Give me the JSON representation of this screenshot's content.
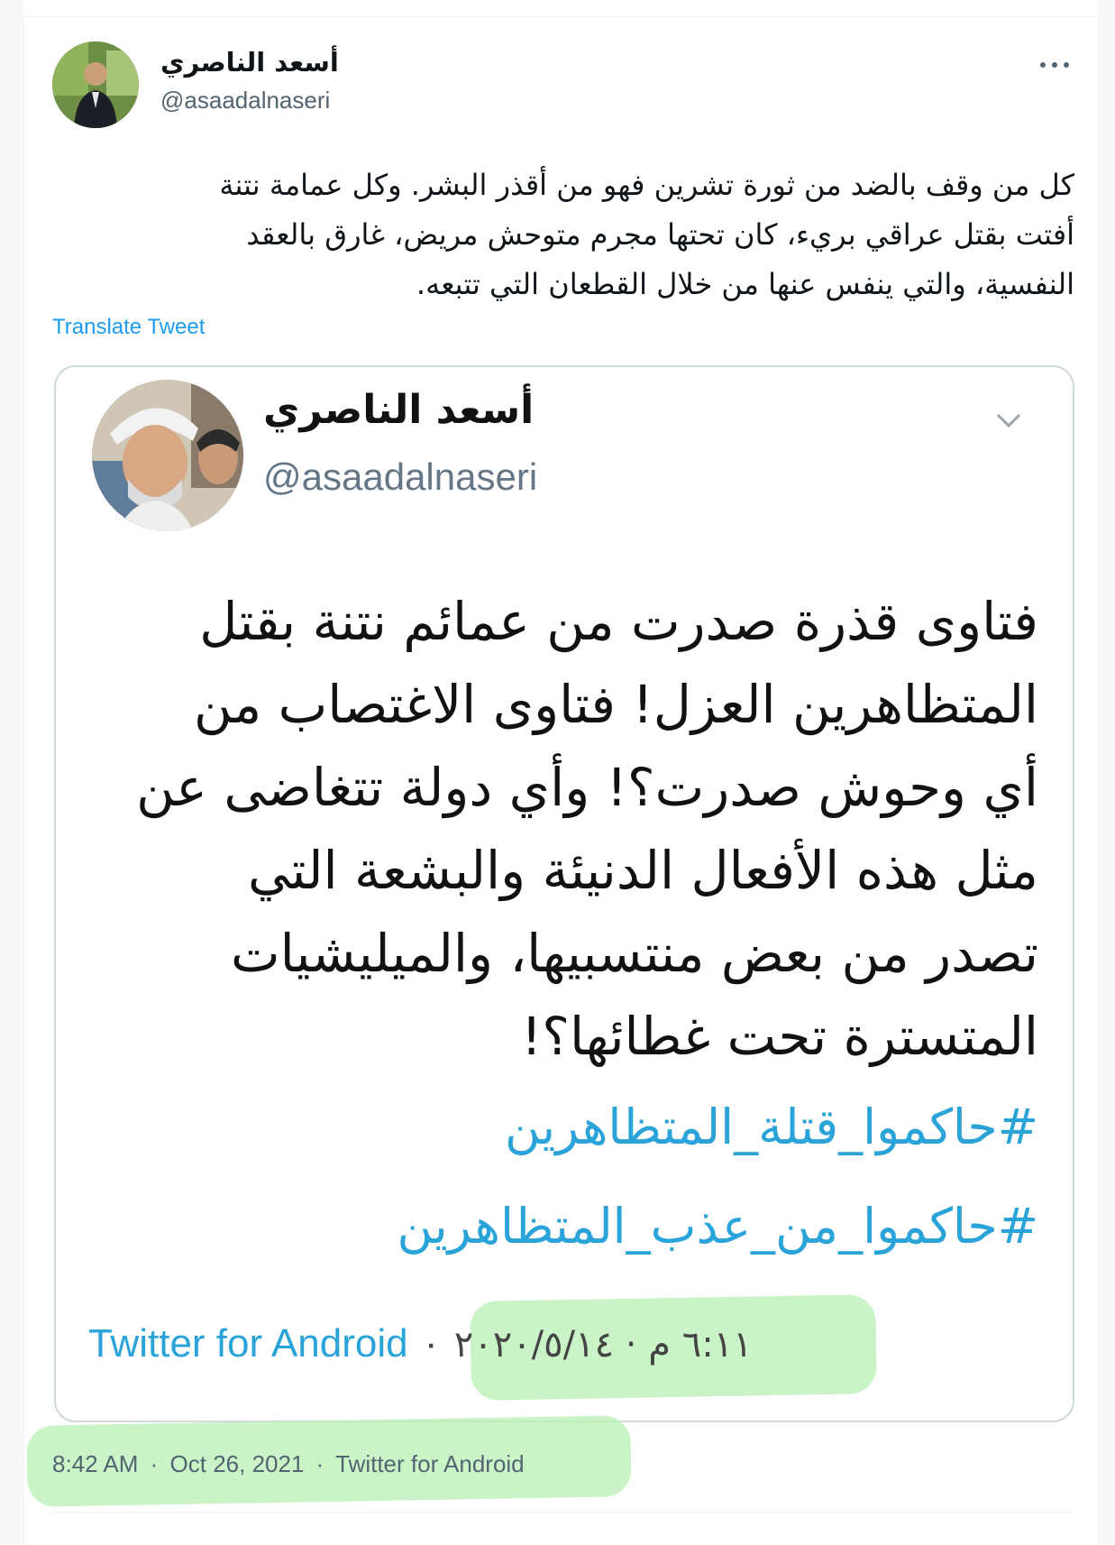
{
  "tweet": {
    "display_name": "أسعد الناصري",
    "handle": "@asaadalnaseri",
    "text_lines": [
      "كل من وقف بالضد من ثورة تشرين فهو من أقذر البشر. وكل عمامة نتنة",
      "أفتت بقتل عراقي بريء، كان تحتها مجرم متوحش مريض، غارق بالعقد",
      "النفسية، والتي ينفس عنها من خلال القطعان التي تتبعه."
    ],
    "translate_label": "Translate Tweet",
    "time": "8:42 AM",
    "date": "Oct 26, 2021",
    "source": "Twitter for Android",
    "separator": "·"
  },
  "quoted": {
    "display_name": "أسعد الناصري",
    "handle": "@asaadalnaseri",
    "body_lines": [
      "فتاوى قذرة صدرت من عمائم نتنة بقتل",
      "المتظاهرين العزل! فتاوى الاغتصاب من",
      "أي وحوش صدرت؟! وأي دولة تتغاضى عن",
      "مثل هذه الأفعال الدنيئة والبشعة التي",
      "تصدر من بعض منتسبيها، والميليشيات",
      "المتسترة تحت غطائها؟!"
    ],
    "hashtags": [
      "#حاكموا_قتلة_المتظاهرين",
      "#حاكموا_من_عذب_المتظاهرين"
    ],
    "source": "Twitter for Android",
    "date": "٦:١١ م · ٢٠٢٠/٥/١٤",
    "separator": "·"
  },
  "colors": {
    "link": "#1d9bf0",
    "quoted_link": "#2aa3d8",
    "highlight": "#b8f0b4",
    "muted": "#536471"
  },
  "icons": {
    "more": "more-horizontal-icon",
    "chevron": "chevron-down-icon"
  }
}
